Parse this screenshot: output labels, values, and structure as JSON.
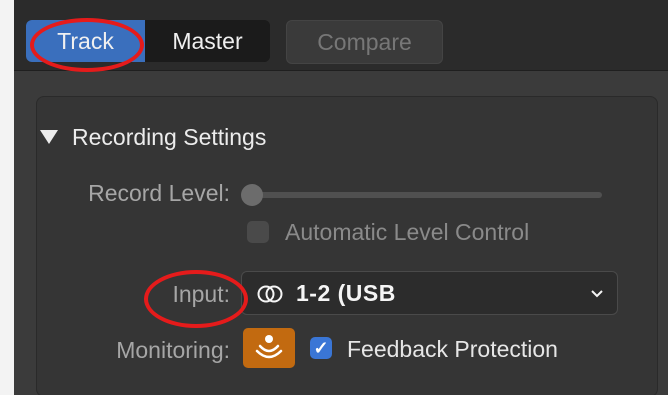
{
  "toolbar": {
    "tab_track": "Track",
    "tab_master": "Master",
    "compare": "Compare"
  },
  "recording_settings": {
    "section_title": "Recording Settings",
    "record_level_label": "Record Level:",
    "record_level_value": 0,
    "automatic_level_control_label": "Automatic Level Control",
    "automatic_level_control_checked": false,
    "input_label": "Input:",
    "input_value": "1-2  (USB",
    "monitoring_label": "Monitoring:",
    "feedback_protection_label": "Feedback Protection",
    "feedback_protection_checked": true
  },
  "colors": {
    "accent_blue": "#3a6fbd",
    "monitor_orange": "#c26a10",
    "annotation_red": "#e51b1b"
  },
  "icons": [
    "stereo-link-icon",
    "chevron-down-icon",
    "monitoring-icon",
    "checkmark-icon",
    "disclosure-triangle-icon"
  ]
}
